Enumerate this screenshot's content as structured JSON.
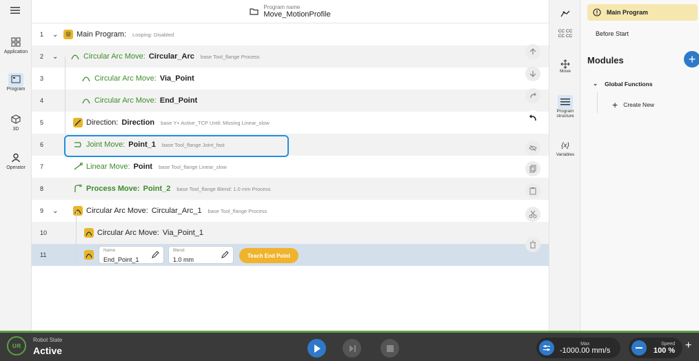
{
  "left_nav": {
    "items": [
      {
        "label": "Application",
        "icon": "grid-icon"
      },
      {
        "label": "Program",
        "icon": "program-icon"
      },
      {
        "label": "3D",
        "icon": "cube-icon"
      },
      {
        "label": "Operator",
        "icon": "person-icon"
      }
    ]
  },
  "header": {
    "program_label": "Program name",
    "program_name": "Move_MotionProfile"
  },
  "tree": {
    "rows": [
      {
        "num": "1",
        "kind": "Main Program:",
        "name": "",
        "meta": "Looping: Disabled"
      },
      {
        "num": "2",
        "kind": "Circular Arc Move:",
        "name": "Circular_Arc",
        "meta": "base  Tool_flange  Process"
      },
      {
        "num": "3",
        "kind": "Circular Arc Move:",
        "name": "Via_Point",
        "meta": ""
      },
      {
        "num": "4",
        "kind": "Circular Arc Move:",
        "name": "End_Point",
        "meta": ""
      },
      {
        "num": "5",
        "kind": "Direction:",
        "name": "Direction",
        "meta": "base  Y+  Active_TCP  Until: Missing  Linear_slow"
      },
      {
        "num": "6",
        "kind": "Joint Move:",
        "name": "Point_1",
        "meta": "base  Tool_flange  Joint_fast"
      },
      {
        "num": "7",
        "kind": "Linear Move:",
        "name": "Point",
        "meta": "base  Tool_flange  Linear_slow"
      },
      {
        "num": "8",
        "kind": "Process Move:",
        "name": "Point_2",
        "meta": "base  Tool_flange  Blend: 1.0 mm  Process"
      },
      {
        "num": "9",
        "kind": "Circular Arc Move:",
        "name": "Circular_Arc_1",
        "meta": "base  Tool_flange  Process"
      },
      {
        "num": "10",
        "kind": "Circular Arc Move:",
        "name": "Via_Point_1",
        "meta": ""
      },
      {
        "num": "11",
        "kind": "",
        "name": "",
        "meta": ""
      }
    ],
    "edit": {
      "name_label": "Name",
      "name_value": "End_Point_1",
      "blend_label": "Blend",
      "blend_value": "1.0 mm",
      "teach_label": "Teach End Point"
    }
  },
  "right_nav": {
    "items": [
      {
        "label": "",
        "icon": "robot-icon"
      },
      {
        "label": "CC CC\nCC CC",
        "icon": "cc-icon"
      },
      {
        "label": "Move",
        "icon": "move-icon"
      },
      {
        "label": "Program structure",
        "icon": "list-icon"
      },
      {
        "label": "Variables",
        "icon": "variables-icon"
      }
    ],
    "cc_text_1": "CC CC",
    "cc_text_2": "CC CC",
    "move_label": "Move",
    "structure_label_1": "Program",
    "structure_label_2": "structure",
    "variables_glyph": "{x}",
    "variables_label": "Variables"
  },
  "panel": {
    "main_program": "Main Program",
    "before_start": "Before Start",
    "modules_title": "Modules",
    "global_functions": "Global Functions",
    "create_new": "Create New"
  },
  "bottom": {
    "robot_state_label": "Robot State",
    "robot_state_value": "Active",
    "max_label": "Max",
    "max_value": "-1000.00 mm/s",
    "speed_label": "Speed",
    "speed_value": "100 %"
  },
  "colors": {
    "accent_blue": "#1f8fe0",
    "program_green": "#3b8c2a",
    "move_yellow": "#e7b62a",
    "status_green": "#5aa040"
  }
}
